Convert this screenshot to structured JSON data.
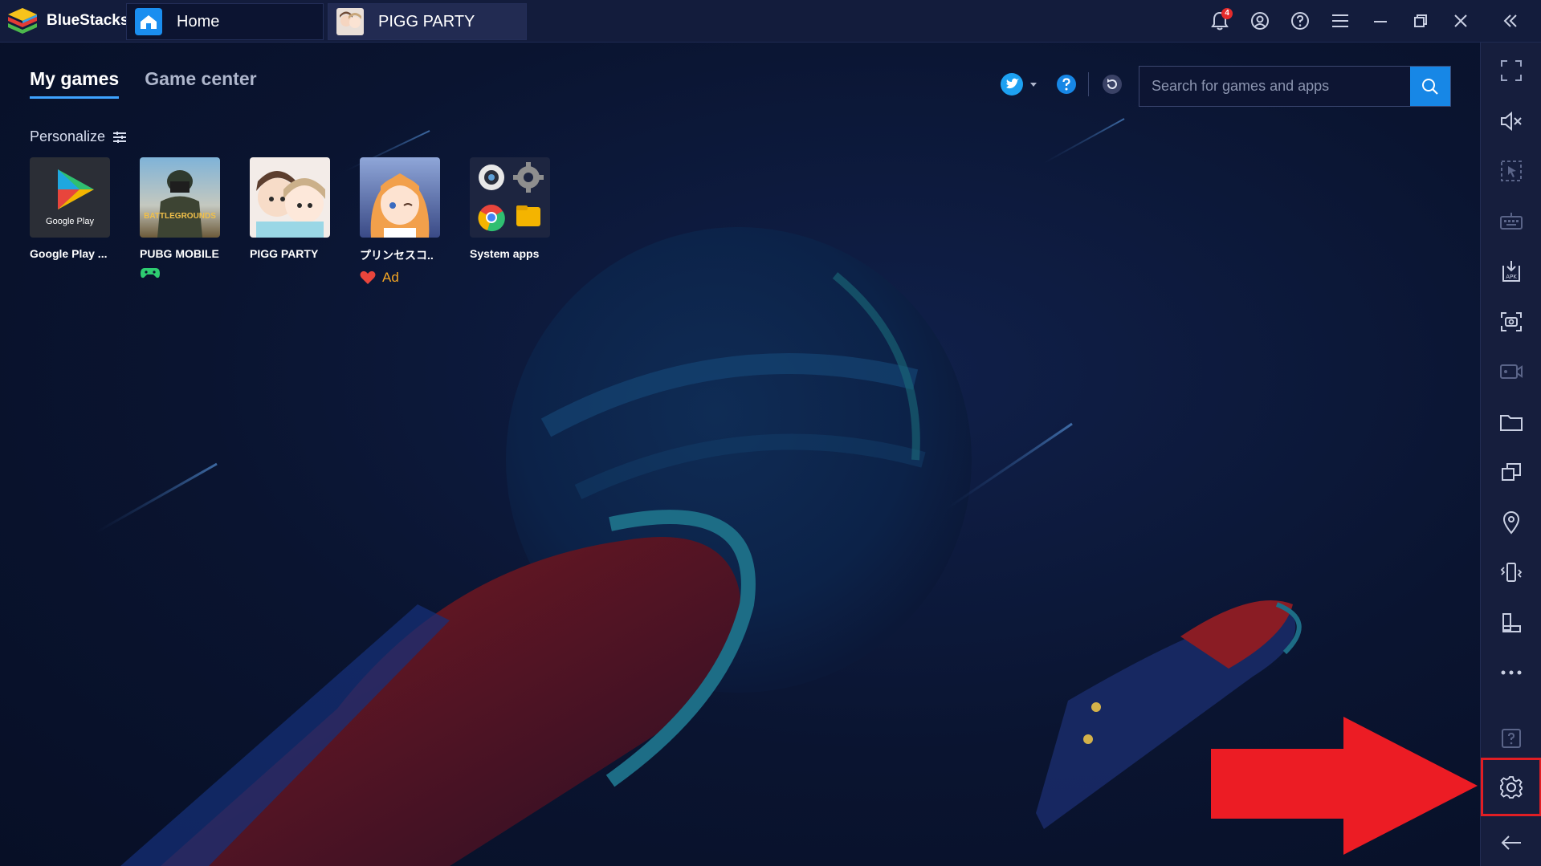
{
  "app": {
    "name": "BlueStacks"
  },
  "tabs": [
    {
      "label": "Home"
    },
    {
      "label": "PIGG PARTY"
    }
  ],
  "titlebar": {
    "notification_count": "4"
  },
  "section_tabs": {
    "my_games": "My games",
    "game_center": "Game center"
  },
  "personalize": {
    "label": "Personalize"
  },
  "search": {
    "placeholder": "Search for games and apps"
  },
  "games": [
    {
      "name": "Google Play ...",
      "icon_caption": "Google Play"
    },
    {
      "name": "PUBG MOBILE",
      "icon_caption": "BATTLEGROUNDS"
    },
    {
      "name": "PIGG PARTY"
    },
    {
      "name": "プリンセスコ..",
      "extra": "Ad"
    },
    {
      "name": "System apps"
    }
  ],
  "sidebar_icons": [
    "fullscreen-icon",
    "volume-mute-icon",
    "pointer-icon",
    "keyboard-icon",
    "apk-install-icon",
    "screenshot-icon",
    "record-icon",
    "folder-icon",
    "multi-instance-icon",
    "location-icon",
    "shake-icon",
    "rotate-icon",
    "more-icon",
    "help-icon",
    "settings-icon",
    "back-icon"
  ],
  "colors": {
    "accent": "#1787e6",
    "highlight": "#e01e24",
    "background": "#0b1530"
  }
}
